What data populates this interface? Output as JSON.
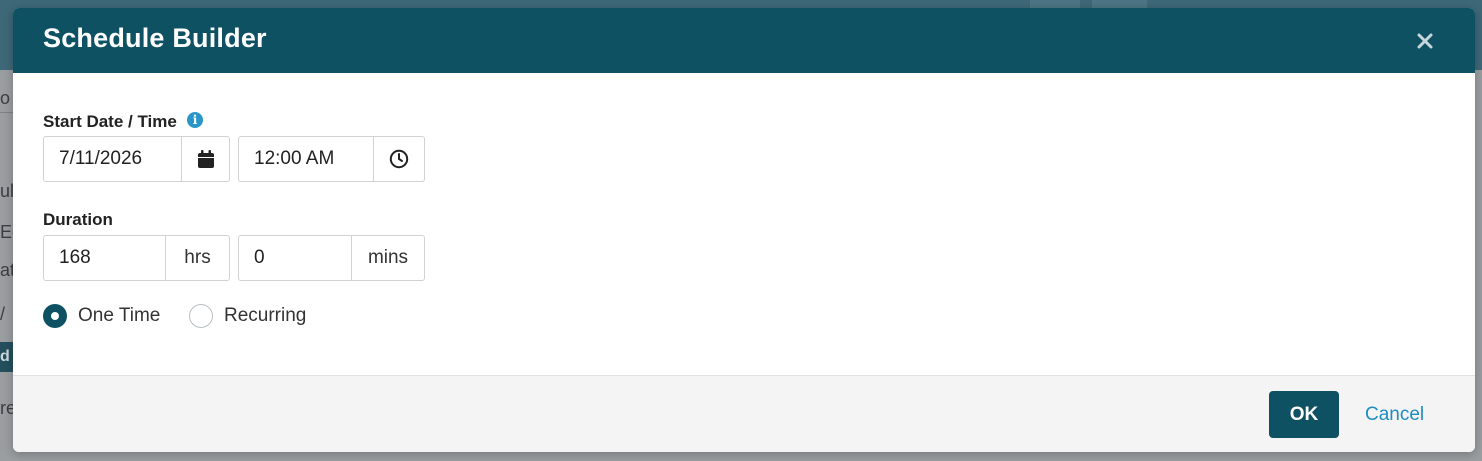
{
  "background": {
    "fragments": [
      "o",
      "ul",
      "Ed",
      "at",
      "/",
      "d",
      "re"
    ]
  },
  "dialog": {
    "title": "Schedule Builder",
    "close_icon": "close-icon",
    "start": {
      "label": "Start Date / Time",
      "info_icon": "info-icon",
      "date": "7/11/2026",
      "date_icon": "calendar-icon",
      "time": "12:00 AM",
      "time_icon": "clock-icon"
    },
    "duration": {
      "label": "Duration",
      "hours": "168",
      "hours_unit": "hrs",
      "minutes": "0",
      "minutes_unit": "mins"
    },
    "schedule_type": {
      "options": [
        {
          "label": "One Time",
          "selected": true
        },
        {
          "label": "Recurring",
          "selected": false
        }
      ]
    },
    "footer": {
      "ok_label": "OK",
      "cancel_label": "Cancel"
    }
  },
  "colors": {
    "header_bg": "#0d5163",
    "primary_button": "#0d5163",
    "link": "#1e8dc0",
    "info": "#2a96c8"
  }
}
